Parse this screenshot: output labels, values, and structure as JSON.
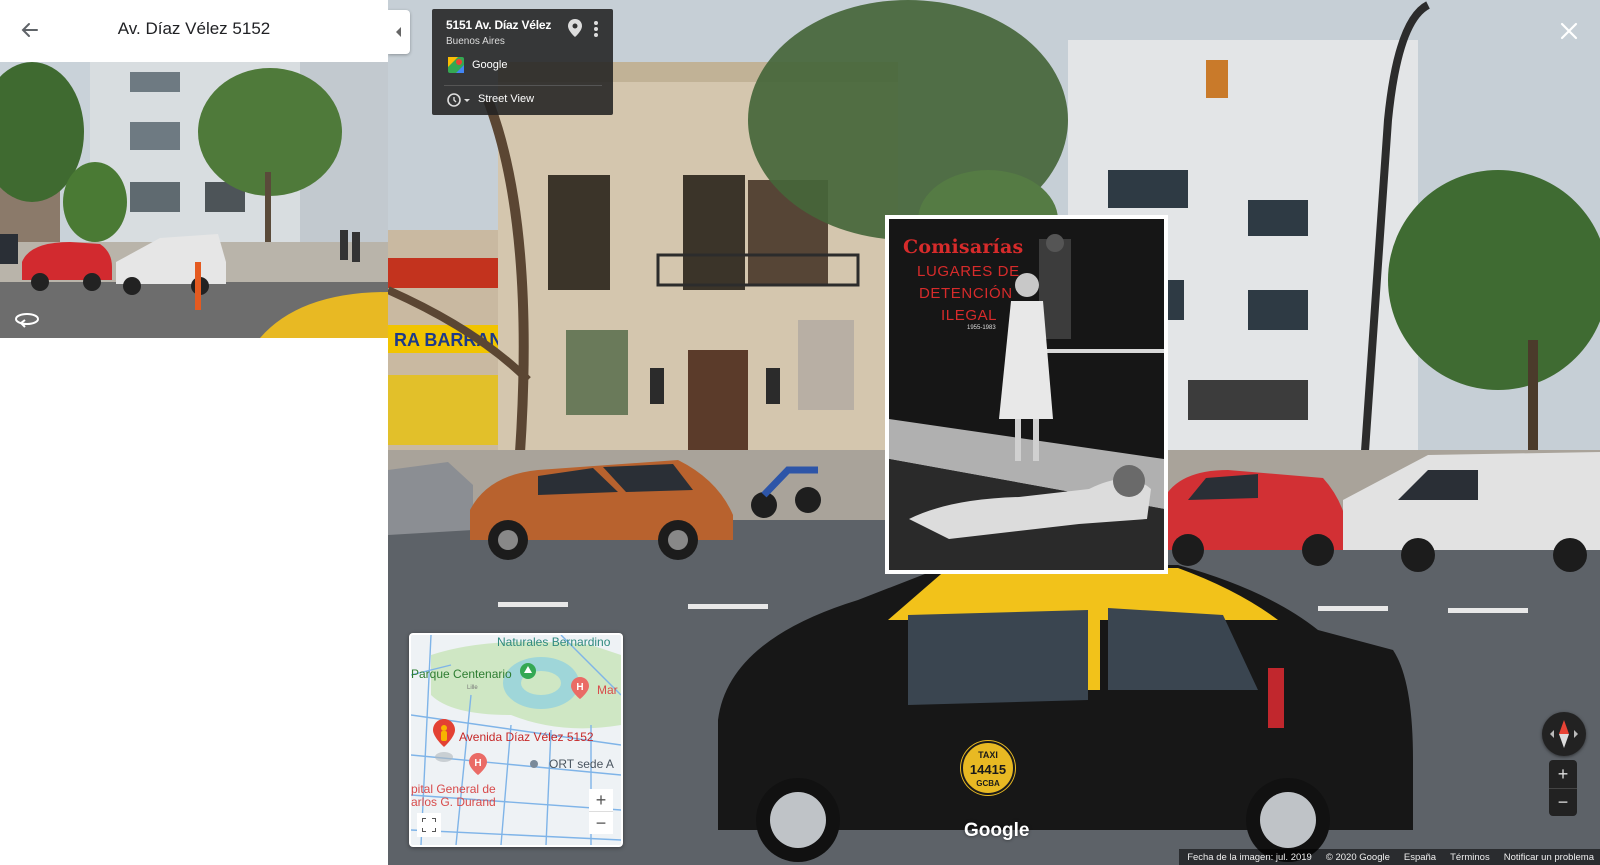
{
  "panel": {
    "title": "Av. Díaz Vélez 5152"
  },
  "info_card": {
    "title": "5151 Av. Díaz Vélez",
    "city": "Buenos Aires",
    "provider": "Google",
    "mode": "Street View"
  },
  "poster": {
    "title": "Comisarías",
    "line1": "LUGARES DE",
    "line2": "DETENCIÓN",
    "line3": "ILEGAL",
    "years": "1955-1983"
  },
  "taxi": {
    "label": "TAXI",
    "number": "14415",
    "agency": "GCBA"
  },
  "storefront": {
    "sign": "RA BARRANCO"
  },
  "minimap": {
    "labels": {
      "naturales": "Naturales Bernardino",
      "parque": "Parque Centenario",
      "mar": "Mar",
      "avenida": "Avenida Díaz Vélez 5152",
      "ort": "ORT sede A",
      "hospital1": "pital General de",
      "hospital2": "arlos G. Durand",
      "lille": "Lille"
    },
    "zoom_in": "+",
    "zoom_out": "−"
  },
  "controls": {
    "zoom_in": "+",
    "zoom_out": "−"
  },
  "watermark": "Google",
  "footer": {
    "date": "Fecha de la imagen: jul. 2019",
    "copyright": "© 2020 Google",
    "country": "España",
    "terms": "Términos",
    "report": "Notificar un problema"
  },
  "icons": [
    "back-arrow-icon",
    "rotate-360-icon",
    "collapse-chevron-icon",
    "location-pin-icon",
    "more-vert-icon",
    "google-maps-logo-icon",
    "history-clock-icon",
    "close-icon",
    "compass-icon",
    "fullscreen-icon",
    "pegman-icon",
    "park-tree-icon",
    "hospital-icon"
  ],
  "colors": {
    "poster_red": "#d72b2b",
    "taxi_yellow": "#f2c21a",
    "map_pin_red": "#e34133",
    "card_bg": "#222222"
  }
}
